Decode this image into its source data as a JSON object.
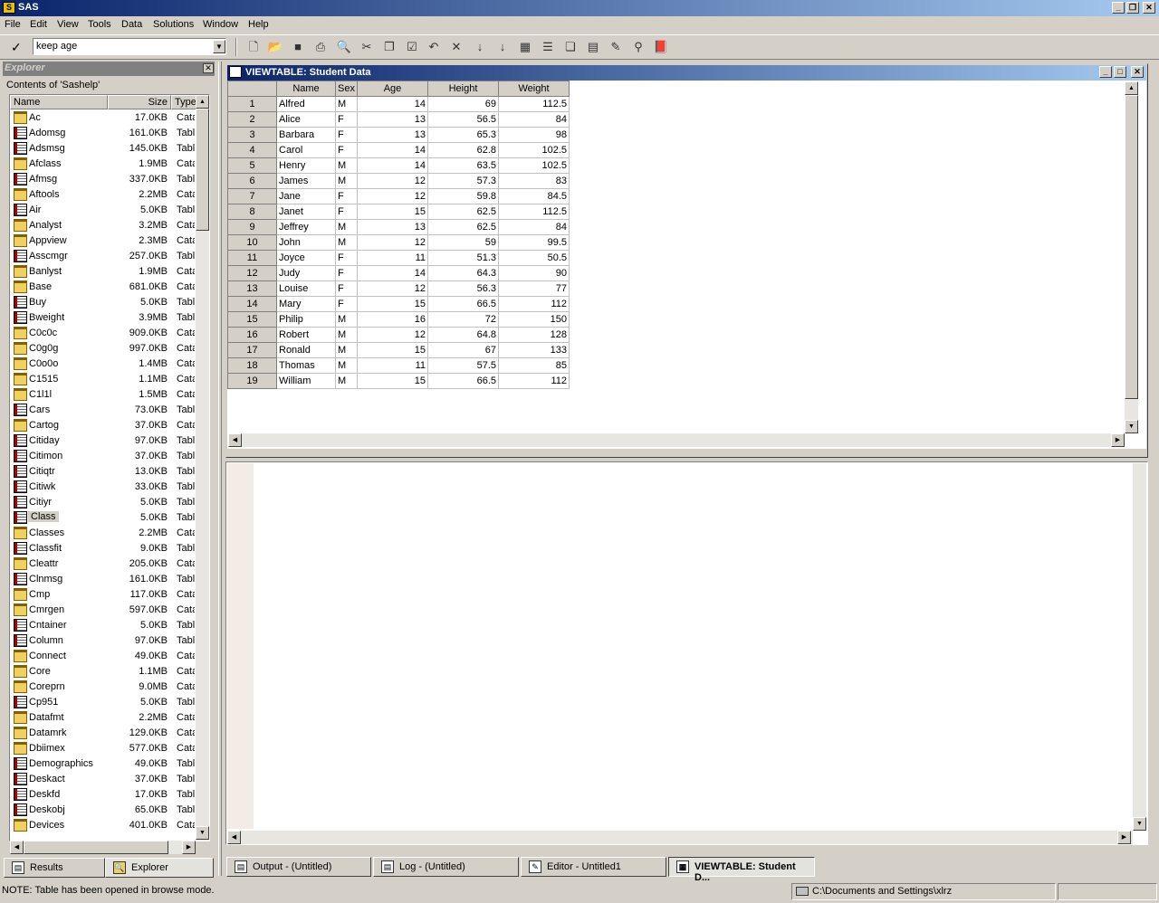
{
  "app": {
    "title": "SAS",
    "icon_label": "S"
  },
  "window_controls": {
    "minimize": "_",
    "restore": "❐",
    "close": "✕"
  },
  "menu": [
    "File",
    "Edit",
    "View",
    "Tools",
    "Data",
    "Solutions",
    "Window",
    "Help"
  ],
  "command_box": {
    "value": "keep age"
  },
  "explorer": {
    "title": "Explorer",
    "contents_label": "Contents of 'Sashelp'",
    "columns": {
      "name": "Name",
      "size": "Size",
      "type": "Type"
    },
    "items": [
      {
        "name": "Ac",
        "size": "17.0KB",
        "type": "Catalog",
        "icon": "folder-icon"
      },
      {
        "name": "Adomsg",
        "size": "161.0KB",
        "type": "Table",
        "icon": "table-icon"
      },
      {
        "name": "Adsmsg",
        "size": "145.0KB",
        "type": "Table",
        "icon": "table-icon"
      },
      {
        "name": "Afclass",
        "size": "1.9MB",
        "type": "Catalog",
        "icon": "folder-icon"
      },
      {
        "name": "Afmsg",
        "size": "337.0KB",
        "type": "Table",
        "icon": "table-icon"
      },
      {
        "name": "Aftools",
        "size": "2.2MB",
        "type": "Catalog",
        "icon": "folder-icon"
      },
      {
        "name": "Air",
        "size": "5.0KB",
        "type": "Table",
        "icon": "table-icon"
      },
      {
        "name": "Analyst",
        "size": "3.2MB",
        "type": "Catalog",
        "icon": "folder-icon"
      },
      {
        "name": "Appview",
        "size": "2.3MB",
        "type": "Catalog",
        "icon": "folder-icon"
      },
      {
        "name": "Asscmgr",
        "size": "257.0KB",
        "type": "Table",
        "icon": "table-icon"
      },
      {
        "name": "Banlyst",
        "size": "1.9MB",
        "type": "Catalog",
        "icon": "folder-icon"
      },
      {
        "name": "Base",
        "size": "681.0KB",
        "type": "Catalog",
        "icon": "folder-icon"
      },
      {
        "name": "Buy",
        "size": "5.0KB",
        "type": "Table",
        "icon": "table-icon"
      },
      {
        "name": "Bweight",
        "size": "3.9MB",
        "type": "Table",
        "icon": "table-icon"
      },
      {
        "name": "C0c0c",
        "size": "909.0KB",
        "type": "Catalog",
        "icon": "folder-icon"
      },
      {
        "name": "C0g0g",
        "size": "997.0KB",
        "type": "Catalog",
        "icon": "folder-icon"
      },
      {
        "name": "C0o0o",
        "size": "1.4MB",
        "type": "Catalog",
        "icon": "folder-icon"
      },
      {
        "name": "C1515",
        "size": "1.1MB",
        "type": "Catalog",
        "icon": "folder-icon"
      },
      {
        "name": "C1l1l",
        "size": "1.5MB",
        "type": "Catalog",
        "icon": "folder-icon"
      },
      {
        "name": "Cars",
        "size": "73.0KB",
        "type": "Table",
        "icon": "table-icon"
      },
      {
        "name": "Cartog",
        "size": "37.0KB",
        "type": "Catalog",
        "icon": "folder-icon"
      },
      {
        "name": "Citiday",
        "size": "97.0KB",
        "type": "Table",
        "icon": "table-icon"
      },
      {
        "name": "Citimon",
        "size": "37.0KB",
        "type": "Table",
        "icon": "table-icon"
      },
      {
        "name": "Citiqtr",
        "size": "13.0KB",
        "type": "Table",
        "icon": "table-icon"
      },
      {
        "name": "Citiwk",
        "size": "33.0KB",
        "type": "Table",
        "icon": "table-icon"
      },
      {
        "name": "Citiyr",
        "size": "5.0KB",
        "type": "Table",
        "icon": "table-icon"
      },
      {
        "name": "Class",
        "size": "5.0KB",
        "type": "Table",
        "icon": "table-icon",
        "selected": true
      },
      {
        "name": "Classes",
        "size": "2.2MB",
        "type": "Catalog",
        "icon": "folder-icon"
      },
      {
        "name": "Classfit",
        "size": "9.0KB",
        "type": "Table",
        "icon": "table-icon"
      },
      {
        "name": "Cleattr",
        "size": "205.0KB",
        "type": "Catalog",
        "icon": "folder-icon"
      },
      {
        "name": "Clnmsg",
        "size": "161.0KB",
        "type": "Table",
        "icon": "table-icon"
      },
      {
        "name": "Cmp",
        "size": "117.0KB",
        "type": "Catalog",
        "icon": "folder-icon"
      },
      {
        "name": "Cmrgen",
        "size": "597.0KB",
        "type": "Catalog",
        "icon": "folder-icon"
      },
      {
        "name": "Cntainer",
        "size": "5.0KB",
        "type": "Table",
        "icon": "table-icon"
      },
      {
        "name": "Column",
        "size": "97.0KB",
        "type": "Table",
        "icon": "table-icon"
      },
      {
        "name": "Connect",
        "size": "49.0KB",
        "type": "Catalog",
        "icon": "folder-icon"
      },
      {
        "name": "Core",
        "size": "1.1MB",
        "type": "Catalog",
        "icon": "folder-icon"
      },
      {
        "name": "Coreprn",
        "size": "9.0MB",
        "type": "Catalog",
        "icon": "folder-icon"
      },
      {
        "name": "Cp951",
        "size": "5.0KB",
        "type": "Table",
        "icon": "table-icon"
      },
      {
        "name": "Datafmt",
        "size": "2.2MB",
        "type": "Catalog",
        "icon": "folder-icon"
      },
      {
        "name": "Datamrk",
        "size": "129.0KB",
        "type": "Catalog",
        "icon": "folder-icon"
      },
      {
        "name": "Dbiimex",
        "size": "577.0KB",
        "type": "Catalog",
        "icon": "folder-icon"
      },
      {
        "name": "Demographics",
        "size": "49.0KB",
        "type": "Table",
        "icon": "table-icon"
      },
      {
        "name": "Deskact",
        "size": "37.0KB",
        "type": "Table",
        "icon": "table-icon"
      },
      {
        "name": "Deskfd",
        "size": "17.0KB",
        "type": "Table",
        "icon": "table-icon"
      },
      {
        "name": "Deskobj",
        "size": "65.0KB",
        "type": "Table",
        "icon": "table-icon"
      },
      {
        "name": "Devices",
        "size": "401.0KB",
        "type": "Catalog",
        "icon": "folder-icon"
      }
    ],
    "tabs": {
      "results": "Results",
      "explorer": "Explorer"
    }
  },
  "viewtable": {
    "title": "VIEWTABLE: Student Data",
    "columns": [
      "Name",
      "Sex",
      "Age",
      "Height",
      "Weight"
    ],
    "rows": [
      [
        "1",
        "Alfred",
        "M",
        "14",
        "69",
        "112.5"
      ],
      [
        "2",
        "Alice",
        "F",
        "13",
        "56.5",
        "84"
      ],
      [
        "3",
        "Barbara",
        "F",
        "13",
        "65.3",
        "98"
      ],
      [
        "4",
        "Carol",
        "F",
        "14",
        "62.8",
        "102.5"
      ],
      [
        "5",
        "Henry",
        "M",
        "14",
        "63.5",
        "102.5"
      ],
      [
        "6",
        "James",
        "M",
        "12",
        "57.3",
        "83"
      ],
      [
        "7",
        "Jane",
        "F",
        "12",
        "59.8",
        "84.5"
      ],
      [
        "8",
        "Janet",
        "F",
        "15",
        "62.5",
        "112.5"
      ],
      [
        "9",
        "Jeffrey",
        "M",
        "13",
        "62.5",
        "84"
      ],
      [
        "10",
        "John",
        "M",
        "12",
        "59",
        "99.5"
      ],
      [
        "11",
        "Joyce",
        "F",
        "11",
        "51.3",
        "50.5"
      ],
      [
        "12",
        "Judy",
        "F",
        "14",
        "64.3",
        "90"
      ],
      [
        "13",
        "Louise",
        "F",
        "12",
        "56.3",
        "77"
      ],
      [
        "14",
        "Mary",
        "F",
        "15",
        "66.5",
        "112"
      ],
      [
        "15",
        "Philip",
        "M",
        "16",
        "72",
        "150"
      ],
      [
        "16",
        "Robert",
        "M",
        "12",
        "64.8",
        "128"
      ],
      [
        "17",
        "Ronald",
        "M",
        "15",
        "67",
        "133"
      ],
      [
        "18",
        "Thomas",
        "M",
        "11",
        "57.5",
        "85"
      ],
      [
        "19",
        "William",
        "M",
        "15",
        "66.5",
        "112"
      ]
    ]
  },
  "taskbar": {
    "output": "Output - (Untitled)",
    "log": "Log - (Untitled)",
    "editor": "Editor - Untitled1",
    "viewtable": "VIEWTABLE: Student D..."
  },
  "status": {
    "note": "NOTE: Table has been opened in browse mode.",
    "path": "C:\\Documents and Settings\\xlrz"
  },
  "colors": {
    "title_gradient_start": "#0a246a",
    "title_gradient_end": "#a6caf0",
    "face": "#d4d0c8"
  }
}
